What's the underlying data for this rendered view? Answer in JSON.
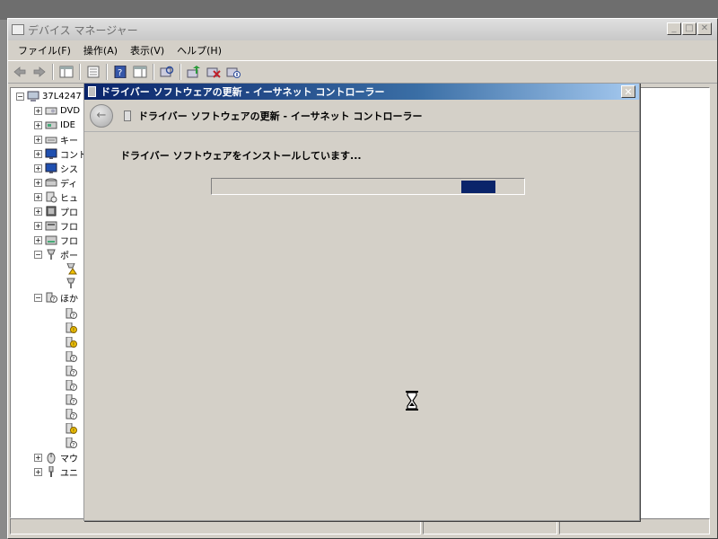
{
  "main_window": {
    "title": "デバイス マネージャー",
    "controls": {
      "minimize": "_",
      "maximize": "□",
      "close": "✕"
    }
  },
  "menu": [
    "ファイル(F)",
    "操作(A)",
    "表示(V)",
    "ヘルプ(H)"
  ],
  "toolbar_icons": [
    "back-arrow-icon",
    "forward-arrow-icon",
    "console-tree-icon",
    "properties-icon",
    "help-icon",
    "action-pane-icon",
    "scan-hardware-icon",
    "update-driver-icon",
    "uninstall-icon",
    "disable-device-icon"
  ],
  "tree": {
    "root": "37L4247",
    "items": [
      "DVD",
      "IDE",
      "キー",
      "コント",
      "シス",
      "ディ",
      "ヒュ",
      "プロ",
      "フロ",
      "フロ",
      "ポー",
      "ほか",
      "マウ",
      "ユニ"
    ]
  },
  "dialog": {
    "title": "ドライバー ソフトウェアの更新 - イーサネット コントローラー",
    "header": "ドライバー ソフトウェアの更新 - イーサネット コントローラー",
    "message": "ドライバー ソフトウェアをインストールしています...",
    "close_glyph": "✕",
    "back_glyph": "←",
    "progress": {
      "chunk_start": 0.8,
      "chunk_end": 0.91
    },
    "accent_color": "#0a246a"
  }
}
